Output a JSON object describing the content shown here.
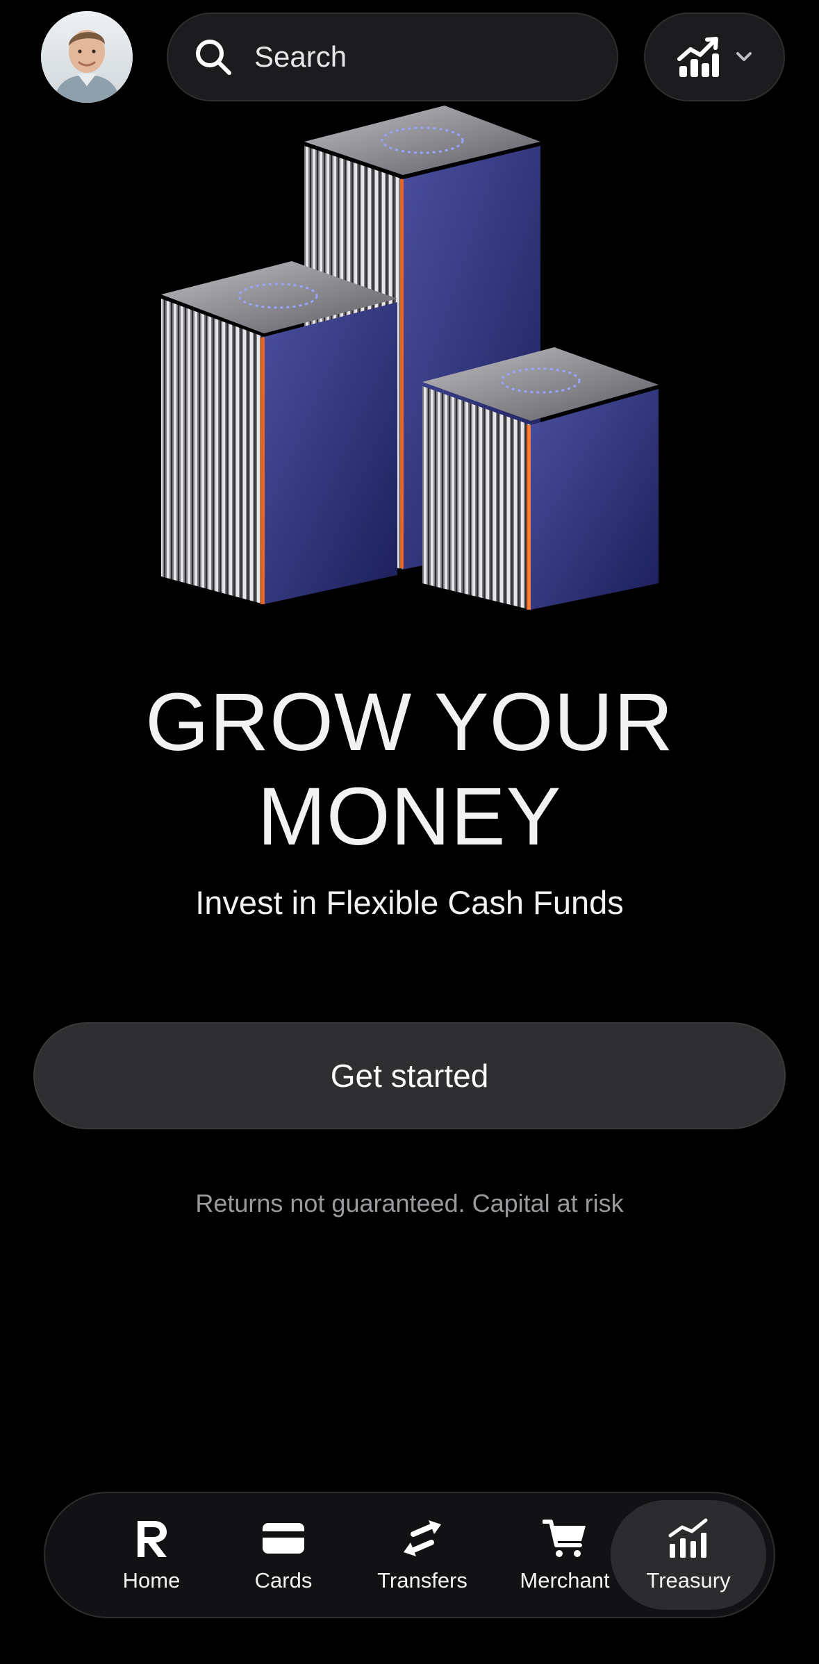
{
  "header": {
    "avatar_icon": "user-avatar",
    "search": {
      "placeholder": "Search",
      "icon": "search-icon"
    },
    "stats_button": {
      "icon": "chart-trend-icon",
      "dropdown_icon": "chevron-down-icon"
    }
  },
  "hero": {
    "illustration": "stacked-cubes-illustration"
  },
  "content": {
    "headline": "GROW YOUR\nMONEY",
    "subtitle": "Invest in Flexible Cash Funds",
    "cta_label": "Get started",
    "disclaimer": "Returns not guaranteed. Capital at risk"
  },
  "bottom_nav": {
    "items": [
      {
        "label": "Home",
        "icon": "revolut-r-icon",
        "active": false
      },
      {
        "label": "Cards",
        "icon": "card-icon",
        "active": false
      },
      {
        "label": "Transfers",
        "icon": "arrows-swap-icon",
        "active": false
      },
      {
        "label": "Merchant",
        "icon": "cart-icon",
        "active": false
      },
      {
        "label": "Treasury",
        "icon": "bar-chart-trend-icon",
        "active": true
      }
    ]
  },
  "colors": {
    "background": "#000000",
    "surface": "#1c1c1e",
    "cta_background": "#2f2f31",
    "active_nav": "#2c2c2f",
    "cube_blue": "#2a2f78",
    "accent_orange": "#ff6a1a"
  }
}
